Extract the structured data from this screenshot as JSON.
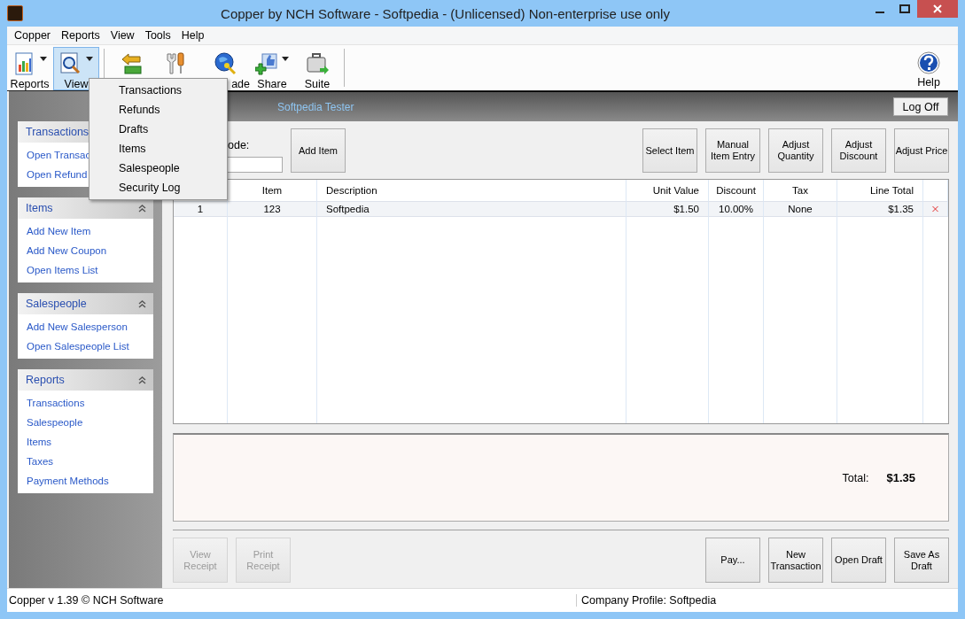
{
  "window": {
    "title": "Copper by NCH Software - Softpedia - (Unlicensed) Non-enterprise use only"
  },
  "menu_bar": [
    "Copper",
    "Reports",
    "View",
    "Tools",
    "Help"
  ],
  "toolbar": [
    {
      "kind": "reports",
      "label": "Reports",
      "dropdown": true,
      "selected": false
    },
    {
      "kind": "view",
      "label": "View",
      "dropdown": true,
      "selected": true
    },
    {
      "kind": "separator"
    },
    {
      "kind": "refund",
      "dropdown": false,
      "selected": false
    },
    {
      "kind": "tools",
      "dropdown": false,
      "selected": false
    },
    {
      "kind": "upgrade",
      "label": "ade",
      "dropdown": false,
      "selected": false
    },
    {
      "kind": "share",
      "label": "Share",
      "dropdown": true,
      "selected": false
    },
    {
      "kind": "suite",
      "label": "Suite",
      "dropdown": false,
      "selected": false
    },
    {
      "kind": "separator"
    }
  ],
  "help_button": {
    "label": "Help"
  },
  "view_menu": {
    "items": [
      "Transactions",
      "Refunds",
      "Drafts",
      "Items",
      "Salespeople",
      "Security Log"
    ]
  },
  "sidebar": [
    {
      "title": "Transactions",
      "links": [
        "Open Transac",
        "Open Refund"
      ]
    },
    {
      "title": "Items",
      "collapse_icon": true,
      "links": [
        "Add New Item",
        "Add New Coupon",
        "Open Items List"
      ]
    },
    {
      "title": "Salespeople",
      "collapse_icon": true,
      "links": [
        "Add New Salesperson",
        "Open Salespeople List"
      ]
    },
    {
      "title": "Reports",
      "collapse_icon": true,
      "links": [
        "Transactions",
        "Salespeople",
        "Items",
        "Taxes",
        "Payment Methods"
      ]
    }
  ],
  "header": {
    "user": "Softpedia Tester",
    "log_off": "Log Off"
  },
  "barcode": {
    "label": "ode:"
  },
  "add_item": "Add Item",
  "action_buttons": [
    "Select Item",
    "Manual\nItem Entry",
    "Adjust\nQuantity",
    "Adjust\nDiscount",
    "Adjust Price"
  ],
  "table": {
    "columns": [
      "",
      "Item",
      "Description",
      "Unit Value",
      "Discount",
      "Tax",
      "Line Total"
    ],
    "rows": [
      {
        "cells": [
          "1",
          "123",
          "Softpedia",
          "$1.50",
          "10.00%",
          "None",
          "$1.35"
        ]
      }
    ]
  },
  "total": {
    "label": "Total:",
    "value": "$1.35"
  },
  "bottom_buttons": [
    {
      "label": "View\nReceipt",
      "disabled": true
    },
    {
      "label": "Print\nReceipt",
      "disabled": true
    },
    {
      "label": "Pay...",
      "disabled": false
    },
    {
      "label": "New\nTransaction",
      "disabled": false
    },
    {
      "label": "Open Draft",
      "disabled": false
    },
    {
      "label": "Save As\nDraft",
      "disabled": false
    }
  ],
  "status_bar": [
    "Copper v 1.39 © NCH Software",
    "Company Profile: Softpedia"
  ]
}
